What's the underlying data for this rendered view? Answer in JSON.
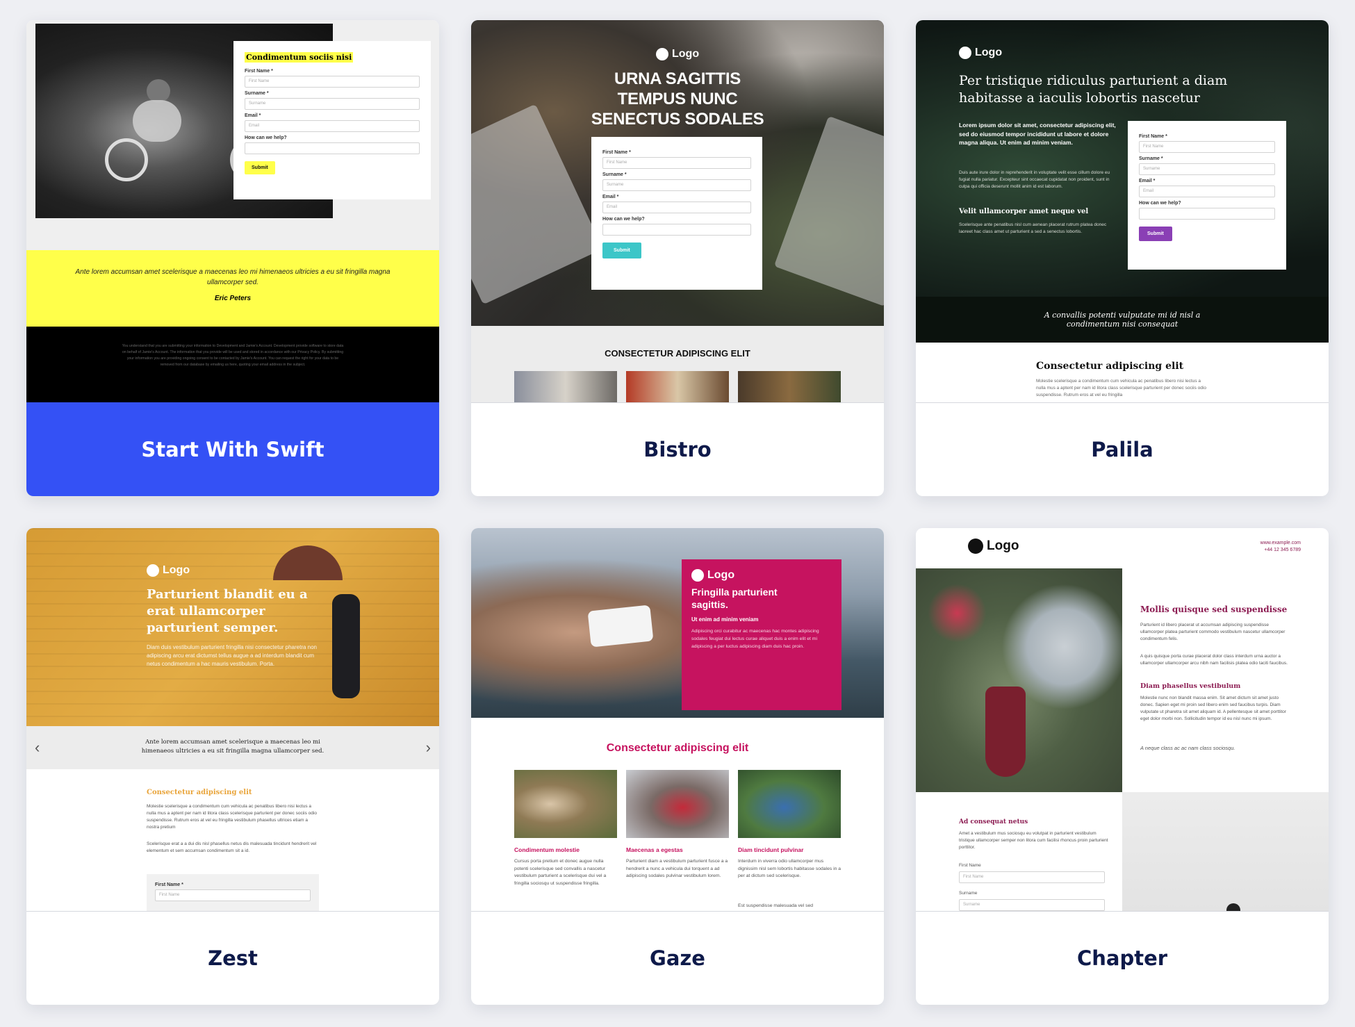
{
  "cards": [
    {
      "title": "Start With Swift",
      "preview": {
        "form_heading": "Condimentum sociis nisi",
        "fields": [
          "First Name *",
          "Surname *",
          "Email *",
          "How can we help?"
        ],
        "placeholders": [
          "First Name",
          "Surname",
          "Email",
          ""
        ],
        "submit": "Submit",
        "quote": "Ante lorem accumsan amet scelerisque a maecenas leo mi himenaeos ultricies a eu sit fringilla magna ullamcorper sed.",
        "quote_author": "Eric Peters",
        "footer_text": "You understand that you are submitting your information to Development and Jamie's Account. Development provide software to store data on behalf of Jamie's Account. The information that you provide will be used and stored in accordance with our Privacy Policy. By submitting your information you are providing ongoing consent to be contacted by Jamie's Account. You can request the right for your data to be removed from our database by emailing us here, quoting your email address in the subject."
      }
    },
    {
      "title": "Bistro",
      "preview": {
        "logo": "Logo",
        "headline": "URNA SAGITTIS TEMPUS NUNC SENECTUS SODALES",
        "fields": [
          "First Name *",
          "Surname *",
          "Email *",
          "How can we help?"
        ],
        "placeholders": [
          "First Name",
          "Surname",
          "Email",
          ""
        ],
        "submit": "Submit",
        "section_title": "CONSECTETUR ADIPISCING ELIT"
      }
    },
    {
      "title": "Palila",
      "preview": {
        "logo": "Logo",
        "headline": "Per tristique ridiculus parturient a diam habitasse a iaculis lobortis nascetur",
        "lead": "Lorem ipsum dolor sit amet, consectetur adipiscing elit, sed do eiusmod tempor incididunt ut labore et dolore magna aliqua. Ut enim ad minim veniam.",
        "body": "Duis aute irure dolor in reprehenderit in voluptate velit esse cillum dolore eu fugiat nulla pariatur. Excepteur sint occaecat cupidatat non proident, sunt in culpa qui officia deserunt mollit anim id est laborum.",
        "subhead": "Velit ullamcorper amet neque vel",
        "body2": "Scelerisque ante penatibus nisl cum aenean placerat rutrum platea donec laoreet hac class amet ut parturient a sed a senectus lobortis.",
        "fields": [
          "First Name *",
          "Surname *",
          "Email *",
          "How can we help?"
        ],
        "placeholders": [
          "First Name",
          "Surname",
          "Email",
          ""
        ],
        "submit": "Submit",
        "banner": "A convallis potenti vulputate mi id nisl a condimentum nisi consequat",
        "section_title": "Consectetur adipiscing elit",
        "section_body": "Molestie scelerisque a condimentum cum vehicula ac penatibus libero nisi lectus a nulla mus a aptent per nam id litora class scelerisque parturient per donec sociis odio suspendisse. Rutrum eros at vel eu fringilla"
      }
    },
    {
      "title": "Zest",
      "preview": {
        "logo": "Logo",
        "headline": "Parturient blandit eu a erat ullamcorper parturient semper.",
        "body": "Diam duis vestibulum parturient fringilla nisi consectetur pharetra non adipiscing arcu erat dictumst tellus augue a ad interdum blandit cum netus condimentum a hac mauris vestibulum. Porta.",
        "quote": "Ante lorem accumsan amet scelerisque a maecenas leo mi himenaeos ultricies a eu sit fringilla magna ullamcorper sed.",
        "section_title": "Consectetur adipiscing elit",
        "section_body": "Molestie scelerisque a condimentum cum vehicula ac penatibus libero nisi lectus a nulla mus a aptent per nam id litora class scelerisque parturient per donec sociis odio suspendisse. Rutrum eros at vel eu fringilla vestibulum phasellus ultrices etiam a nostra pretium",
        "section_body2": "Scelerisque erat a a dui dis nisl phasellus netus dis malesuada tincidunt hendrerit vel elementum et sem accumsan condimentum sit a id.",
        "field": "First Name *",
        "placeholder": "First Name"
      }
    },
    {
      "title": "Gaze",
      "preview": {
        "logo": "Logo",
        "headline": "Fringilla parturient sagittis.",
        "subhead": "Ut enim ad minim veniam",
        "body": "Adipiscing orci curabitur ac maecenas hac montes adipiscing sodales feugiat dui lectus curae aliquet duis a enim elit et mi adipiscing a per luctus adipiscing diam duis hac proin.",
        "section_title": "Consectetur adipiscing elit",
        "columns": [
          {
            "title": "Condimentum molestie",
            "body": "Cursus porta pretium et donec augue nulla potenti scelerisque sed convallis a nascetur vestibulum parturient a scelerisque dui vel a fringilla sociosqu ut suspendisse fringilla."
          },
          {
            "title": "Maecenas a egestas",
            "body": "Parturient diam a vestibulum parturient fusce a a hendrerit a nunc a vehicula dui torquent a ad adipiscing sodales pulvinar vestibulum lorem."
          },
          {
            "title": "Diam tincidunt pulvinar",
            "body": "Interdum in viverra odio ullamcorper mus dignissim nisl sem lobortis habitasse sodales in a per at dictum sed scelerisque.",
            "body2": "Est suspendisse malesuada vel sed"
          }
        ]
      }
    },
    {
      "title": "Chapter",
      "preview": {
        "logo": "Logo",
        "contact_url": "www.example.com",
        "contact_phone": "+44 12 345 6789",
        "headline": "Mollis quisque sed suspendisse",
        "body": "Parturient id libero placerat ut accumsan adipiscing suspendisse ullamcorper platea parturient commodo vestibulum nascetur ullamcorper condimentum felis.",
        "body2": "A quis quisque porta curae placerat dolor class interdum urna auctor a ullamcorper ullamcorper arcu nibh nam facilisis platea odio taciti faucibus.",
        "subhead": "Diam phasellus vestibulum",
        "body3": "Molestie nunc non blandit massa enim. Sit amet dictum sit amet justo donec. Sapien eget mi proin sed libero enim sed faucibus turpis. Diam vulputate ut pharetra sit amet aliquam id. A pellentesque sit amet porttitor eget dolor morbi non. Sollicitudin tempor id eu nisl nunc mi ipsum.",
        "quote": "A neque class ac ac nam class sociosqu.",
        "form_title": "Ad consequat netus",
        "form_body": "Amet a vestibulum mus sociosqu eu volutpat in parturient vestibulum tristique ullamcorper semper non litora cum facilisi rhoncus proin parturient porttitor.",
        "fields": [
          "First Name",
          "Surname"
        ],
        "placeholders": [
          "First Name",
          "Surname"
        ]
      }
    }
  ],
  "colors": {
    "page_bg": "#eeeff3",
    "swift_blue": "#3451f5",
    "swift_yellow": "#ffff4a",
    "title_navy": "#0e1a4a",
    "bistro_teal": "#3cc6c8",
    "palila_purple": "#8a3fb5",
    "gaze_magenta": "#c6135f",
    "chapter_plum": "#8c1c52",
    "zest_orange": "#e9a43a"
  }
}
